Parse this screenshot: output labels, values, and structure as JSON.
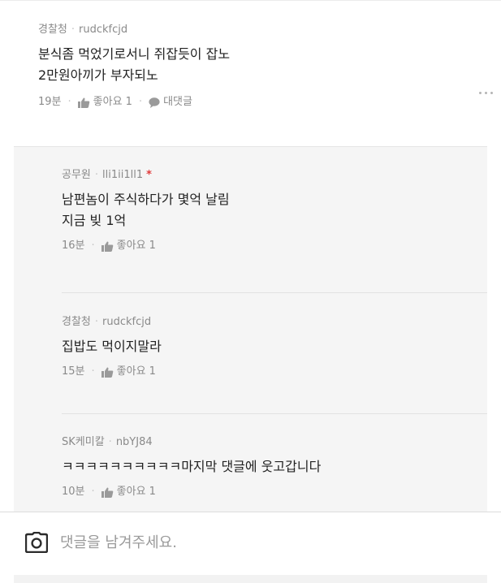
{
  "main_comment": {
    "author_tag": "경찰청",
    "username": "rudckfcjd",
    "lines": [
      "분식좀 먹었기로서니 쥐잡듯이 잡노",
      "2만원아끼가 부자되노"
    ],
    "time": "19분",
    "like_label": "좋아요 1",
    "reply_label": "대댓글"
  },
  "replies": [
    {
      "author_tag": "공무원",
      "username": "lli1ii1ll1",
      "marker": "*",
      "lines": [
        "남편놈이 주식하다가 몇억 날림",
        "지금 빚 1억"
      ],
      "time": "16분",
      "like_label": "좋아요 1"
    },
    {
      "author_tag": "경찰청",
      "username": "rudckfcjd",
      "lines": [
        "집밥도 먹이지말라"
      ],
      "time": "15분",
      "like_label": "좋아요 1"
    },
    {
      "author_tag": "SK케미칼",
      "username": "nbYJ84",
      "lines": [
        "ㅋㅋㅋㅋㅋㅋㅋㅋㅋㅋ마지막 댓글에 웃고갑니다"
      ],
      "time": "10분",
      "like_label": "좋아요 1"
    }
  ],
  "input": {
    "placeholder": "댓글을 남겨주세요."
  },
  "icons": {
    "like": "thumbs-up-icon",
    "reply": "speech-bubble-icon",
    "more": "more-dots-icon",
    "camera": "camera-icon"
  },
  "colors": {
    "text": "#222222",
    "muted": "#8a8a8a",
    "reply_bg": "#f5f5f5",
    "marker": "#e03a3a"
  }
}
